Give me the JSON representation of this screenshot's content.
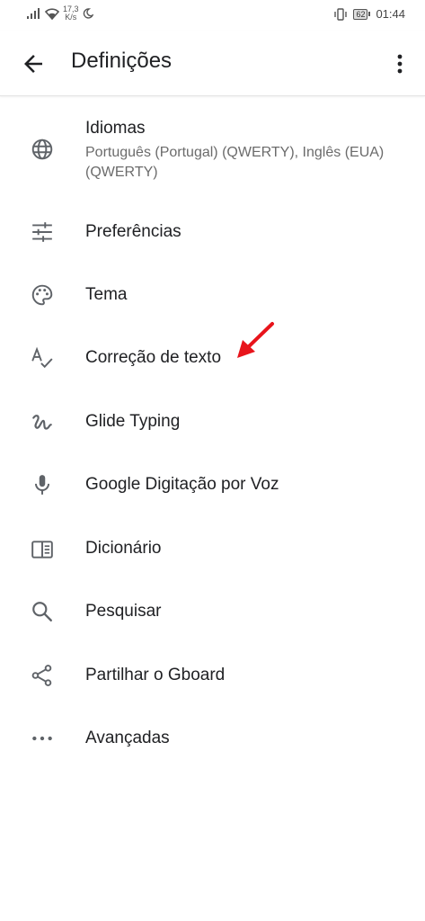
{
  "status_bar": {
    "speed_value": "17,3",
    "speed_unit": "K/s",
    "battery": "62",
    "time": "01:44"
  },
  "app_bar": {
    "title": "Definições"
  },
  "items": [
    {
      "label": "Idiomas",
      "sub": "Português (Portugal) (QWERTY), Inglês (EUA) (QWERTY)",
      "icon": "globe-icon"
    },
    {
      "label": "Preferências",
      "icon": "tune-icon"
    },
    {
      "label": "Tema",
      "icon": "palette-icon"
    },
    {
      "label": "Correção de texto",
      "icon": "spellcheck-icon"
    },
    {
      "label": "Glide Typing",
      "icon": "gesture-icon"
    },
    {
      "label": "Google Digitação por Voz",
      "icon": "mic-icon"
    },
    {
      "label": "Dicionário",
      "icon": "book-icon"
    },
    {
      "label": "Pesquisar",
      "icon": "search-icon"
    },
    {
      "label": "Partilhar o Gboard",
      "icon": "share-icon"
    },
    {
      "label": "Avançadas",
      "icon": "more-horiz-icon"
    }
  ],
  "colors": {
    "icon": "#5f6368",
    "annotation_arrow": "#e8141b"
  }
}
